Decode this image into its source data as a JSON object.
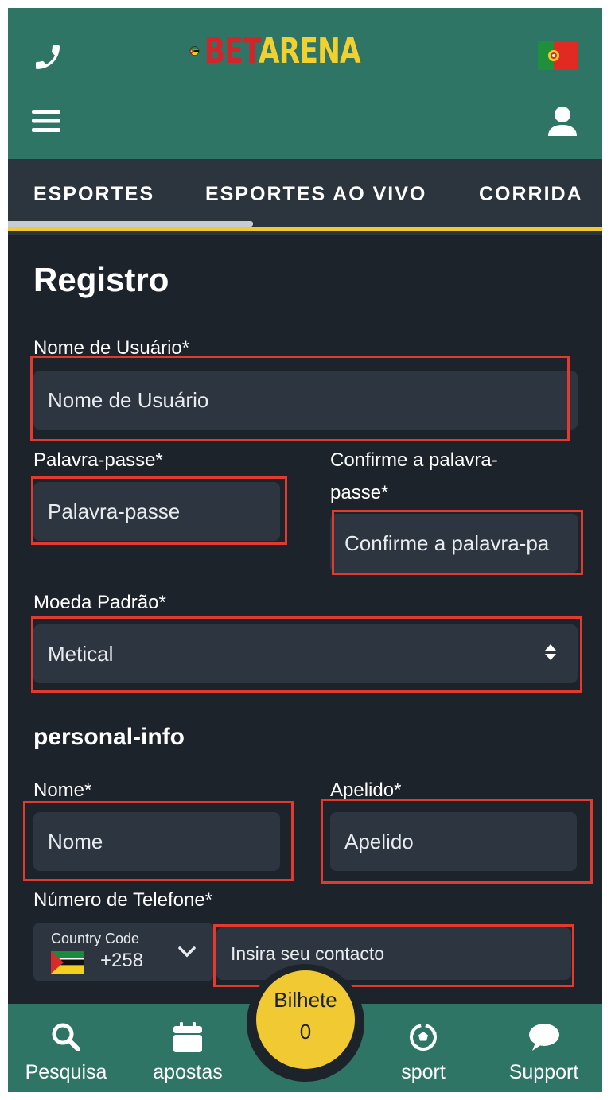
{
  "header": {
    "logo": {
      "part1": "BET",
      "part2": "ARENA"
    },
    "icons": [
      "phone-icon",
      "menu-icon",
      "user-icon",
      "portugal-flag-icon",
      "mozambique-flag-icon"
    ]
  },
  "tabs": [
    {
      "label": "ESPORTES",
      "active": true
    },
    {
      "label": "ESPORTES AO VIVO",
      "active": false
    },
    {
      "label": "CORRIDA",
      "active": false
    }
  ],
  "form": {
    "title": "Registro",
    "username": {
      "label": "Nome de Usuário*",
      "placeholder": "Nome de Usuário"
    },
    "password": {
      "label": "Palavra-passe*",
      "placeholder": "Palavra-passe"
    },
    "confirm_password": {
      "label_line1": "Confirme a palavra-",
      "label_line2": "passe*",
      "placeholder": "Confirme a palavra-pa"
    },
    "currency": {
      "label": "Moeda Padrão*",
      "value": "Metical"
    },
    "section": "personal-info",
    "first_name": {
      "label": "Nome*",
      "placeholder": "Nome"
    },
    "last_name": {
      "label": "Apelido*",
      "placeholder": "Apelido"
    },
    "phone": {
      "label": "Número de Telefone*",
      "country_code_label": "Country Code",
      "country_code": "+258",
      "placeholder": "Insira seu contacto"
    }
  },
  "bottom_nav": {
    "search": "Pesquisa",
    "bets": "apostas",
    "betslip": {
      "label": "Bilhete",
      "count": "0"
    },
    "sport": "sport",
    "support": "Support"
  },
  "colors": {
    "header_bg": "#2f7566",
    "page_bg": "#1c232b",
    "field_bg": "#2d3540",
    "accent_yellow": "#f0c933",
    "highlight_red": "#e23a2e"
  }
}
